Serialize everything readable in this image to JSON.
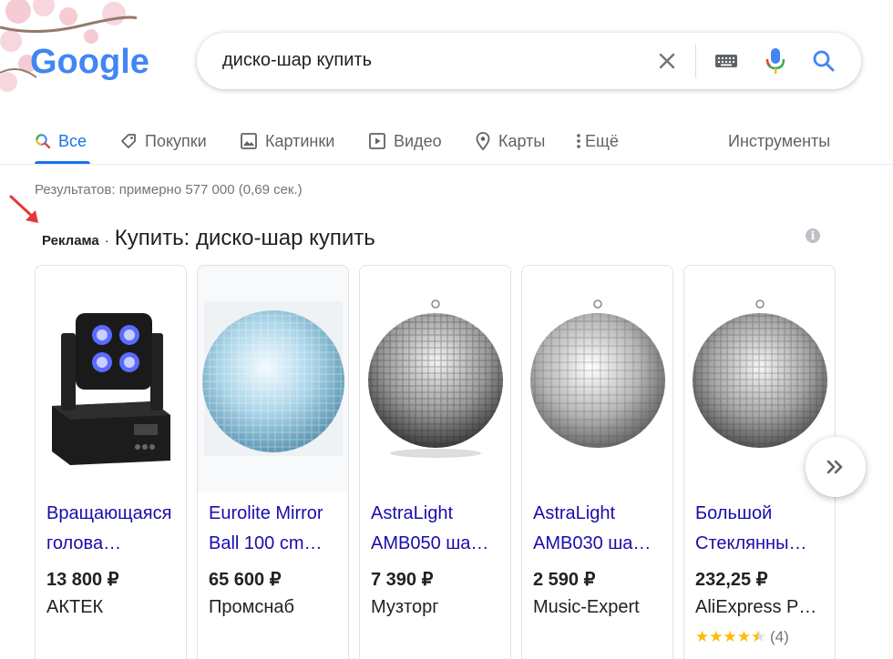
{
  "logo": {
    "text": "Google"
  },
  "search": {
    "query": "диско-шар купить"
  },
  "tabs": [
    {
      "label": "Все",
      "icon": "search-icon"
    },
    {
      "label": "Покупки",
      "icon": "tag-icon"
    },
    {
      "label": "Картинки",
      "icon": "image-icon"
    },
    {
      "label": "Видео",
      "icon": "video-icon"
    },
    {
      "label": "Карты",
      "icon": "map-pin-icon"
    },
    {
      "label": "Ещё",
      "icon": "more-vert-icon"
    }
  ],
  "tools": {
    "label": "Инструменты"
  },
  "stats": {
    "text": "Результатов: примерно 577 000 (0,69 сек.)"
  },
  "ads": {
    "label": "Реклама",
    "separator": "·",
    "title": "Купить: диско-шар купить",
    "info": "i"
  },
  "products": [
    {
      "name": "Вращающаяся голова…",
      "price": "13 800 ₽",
      "seller": "АКТЕК",
      "image": "moving-head-light"
    },
    {
      "name": "Eurolite Mirror Ball 100 cm…",
      "price": "65 600 ₽",
      "seller": "Промснаб",
      "image": "mirror-ball-blue"
    },
    {
      "name": "AstraLight AMB050 ша…",
      "price": "7 390 ₽",
      "seller": "Музторг",
      "image": "mirror-ball-silver"
    },
    {
      "name": "AstraLight AMB030 ша…",
      "price": "2 590 ₽",
      "seller": "Music-Expert",
      "image": "mirror-ball-silver"
    },
    {
      "name": "Большой Стеклянны…",
      "price": "232,25 ₽",
      "seller": "AliExpress P…",
      "image": "mirror-ball-silver",
      "rating": 4.5,
      "reviews": "(4)"
    }
  ],
  "colors": {
    "accent": "#1a73e8",
    "link": "#1a0dab",
    "star": "#fbbc04",
    "arrow": "#e53935"
  }
}
